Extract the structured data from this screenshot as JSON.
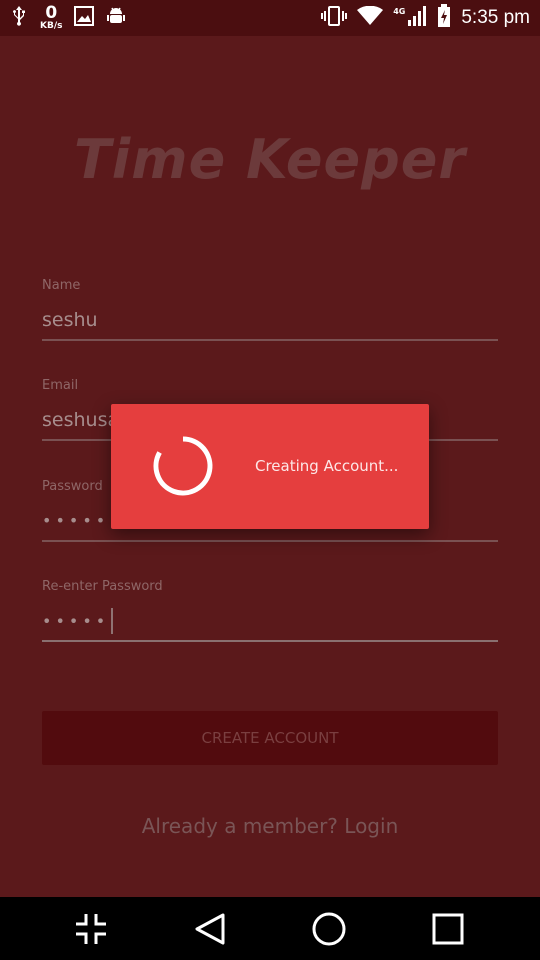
{
  "status_bar": {
    "net_speed_value": "0",
    "net_speed_unit": "KB/s",
    "network_type": "4G",
    "time": "5:35 pm",
    "icons": [
      "usb-icon",
      "image-icon",
      "android-debug-icon",
      "vibrate-icon",
      "wifi-icon",
      "cell-signal-icon",
      "battery-charging-icon"
    ]
  },
  "app": {
    "title": "Time Keeper",
    "fields": {
      "name": {
        "label": "Name",
        "value": "seshu"
      },
      "email": {
        "label": "Email",
        "value": "seshusa"
      },
      "password": {
        "label": "Password",
        "value": "•••••"
      },
      "reenter_password": {
        "label": "Re-enter Password",
        "value": "•••••"
      }
    },
    "create_button": "CREATE ACCOUNT",
    "login_link": "Already a member? Login"
  },
  "dialog": {
    "message": "Creating Account..."
  },
  "nav_bar": {
    "icons": [
      "minimize-icon",
      "back-icon",
      "home-icon",
      "recents-icon"
    ]
  },
  "colors": {
    "background": "#5b191b",
    "dialog": "#e53e3e",
    "status_bar": "#4b0e10"
  }
}
